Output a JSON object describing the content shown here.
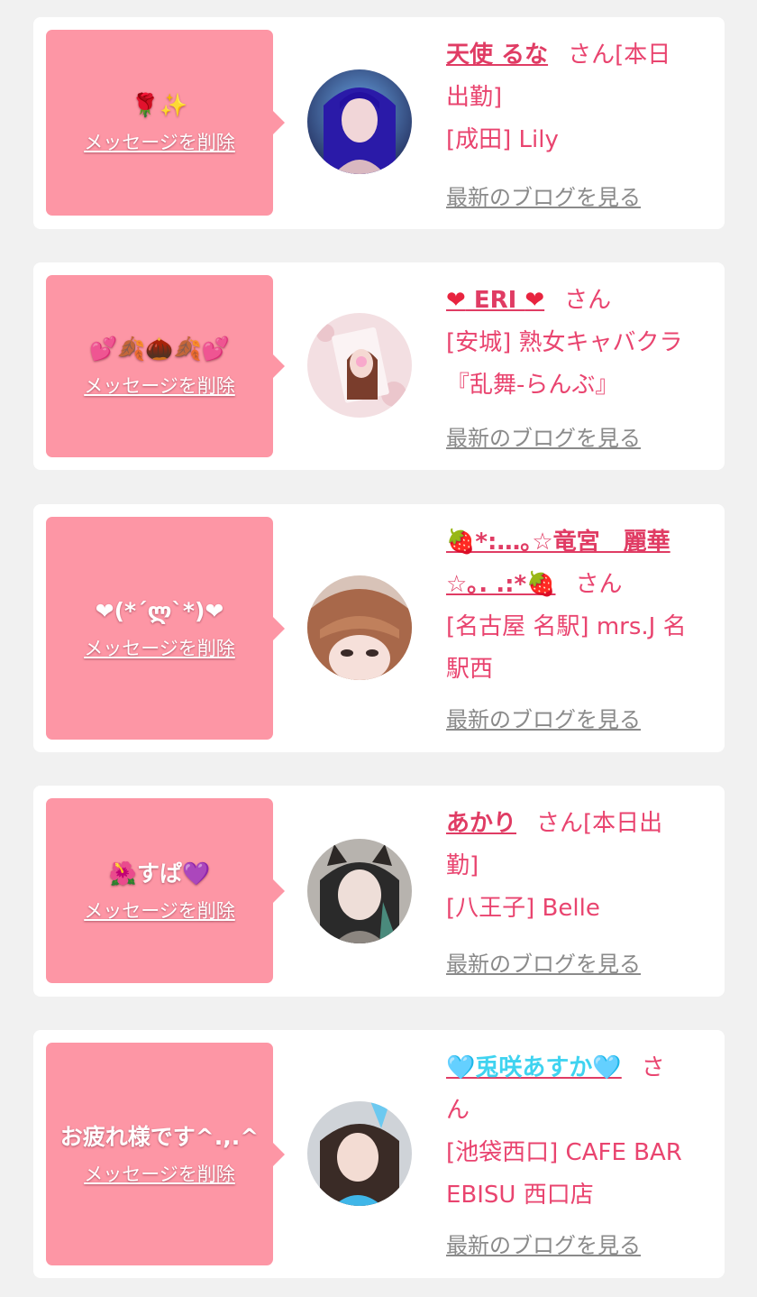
{
  "colors": {
    "page_background": "#f1f1f1",
    "card_background": "#ffffff",
    "bubble_background": "#fd96a5",
    "name_color": "#e03c64",
    "text_pink": "#e9446f",
    "link_gray": "#8a8a8a"
  },
  "messages": [
    {
      "message_text": "🌹✨",
      "delete_label": "メッセージを削除",
      "name": "天使 るな",
      "honorific_line1": "さん[本日",
      "honorific_line2": "出勤]",
      "shop": "[成田] Lily",
      "blog_link": "最新のブログを見る",
      "avatar": "girl-photo-blue-hair"
    },
    {
      "message_text": "💕🍂🌰🍂💕",
      "delete_label": "メッセージを削除",
      "name_prefix_icon": "❤",
      "name": " ERI ",
      "name_suffix_icon": "❤",
      "honorific_line1": "さん",
      "shop": "[安城] 熟女キャバクラ『乱舞-らんぶ』",
      "blog_link": "最新のブログを見る",
      "avatar": "girl-photo-brown-hair"
    },
    {
      "message_text": "❤(*´ლ`*)❤",
      "delete_label": "メッセージを削除",
      "name_line1": "🍓*:…｡☆竜宮　麗華",
      "name_line2": "☆｡. .:*🍓",
      "honorific_line1": "さん",
      "shop": "[名古屋 名駅] mrs.J 名駅西",
      "blog_link": "最新のブログを見る",
      "avatar": "girl-photo-bangs"
    },
    {
      "message_text": "🌺すぱ💜",
      "delete_label": "メッセージを削除",
      "name": "あかり",
      "honorific_line1": "さん[本日出",
      "honorific_line2": "勤]",
      "shop": "[八王子] Belle",
      "blog_link": "最新のブログを見る",
      "avatar": "girl-photo-cat-ears"
    },
    {
      "message_text": "お疲れ様です^.,.^",
      "delete_label": "メッセージを削除",
      "name": "🩵兎咲あすか🩵",
      "honorific_line1": "さ",
      "honorific_line2": "ん",
      "shop": "[池袋西口] CAFE BAR EBISU 西口店",
      "blog_link": "最新のブログを見る",
      "avatar": "girl-photo-bunny-ears"
    }
  ]
}
